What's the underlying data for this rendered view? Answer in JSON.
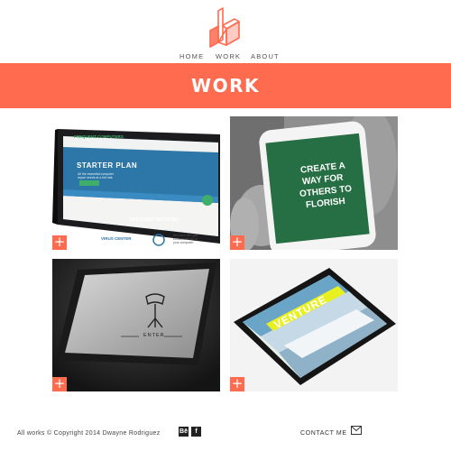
{
  "brand": {
    "logo": "stacked-blocks-logo-icon",
    "accent": "#ff6b4f"
  },
  "nav": {
    "items": [
      "HOME",
      "WORK",
      "ABOUT"
    ]
  },
  "banner": {
    "title": "WORK"
  },
  "works": [
    {
      "kind": "laptop mockup",
      "plus_icon": "+",
      "screen": {
        "brand": "FREQUENT COMPUTERS",
        "headline": "STARTER PLAN",
        "sub_lines": [
          "All the essential computer",
          "repair needs at a full rate"
        ],
        "section": "FREQUENT SERVICES",
        "service": "VIRUS CENTER",
        "side_lines": [
          "We have the right",
          "software for all of",
          "your computer"
        ]
      }
    },
    {
      "kind": "phone mockup",
      "plus_icon": "+",
      "screen": {
        "lines": [
          "CREATE A",
          "WAY FOR",
          "OTHERS TO",
          "FLORISH"
        ]
      }
    },
    {
      "kind": "tablet mockup",
      "plus_icon": "+",
      "screen": {
        "label": "ENTER"
      }
    },
    {
      "kind": "tablet mockup",
      "plus_icon": "+",
      "screen": {
        "headline": "VENTURE"
      }
    }
  ],
  "footer": {
    "copyright": "All works © Copyright 2014 Dwayne Rodriguez",
    "social": [
      {
        "label": "Bē",
        "icon": "behance-icon",
        "color": "#222222"
      },
      {
        "label": "f",
        "icon": "facebook-icon",
        "color": "#222222"
      }
    ],
    "contact": "CONTACT ME",
    "contact_icon": "envelope-icon"
  }
}
